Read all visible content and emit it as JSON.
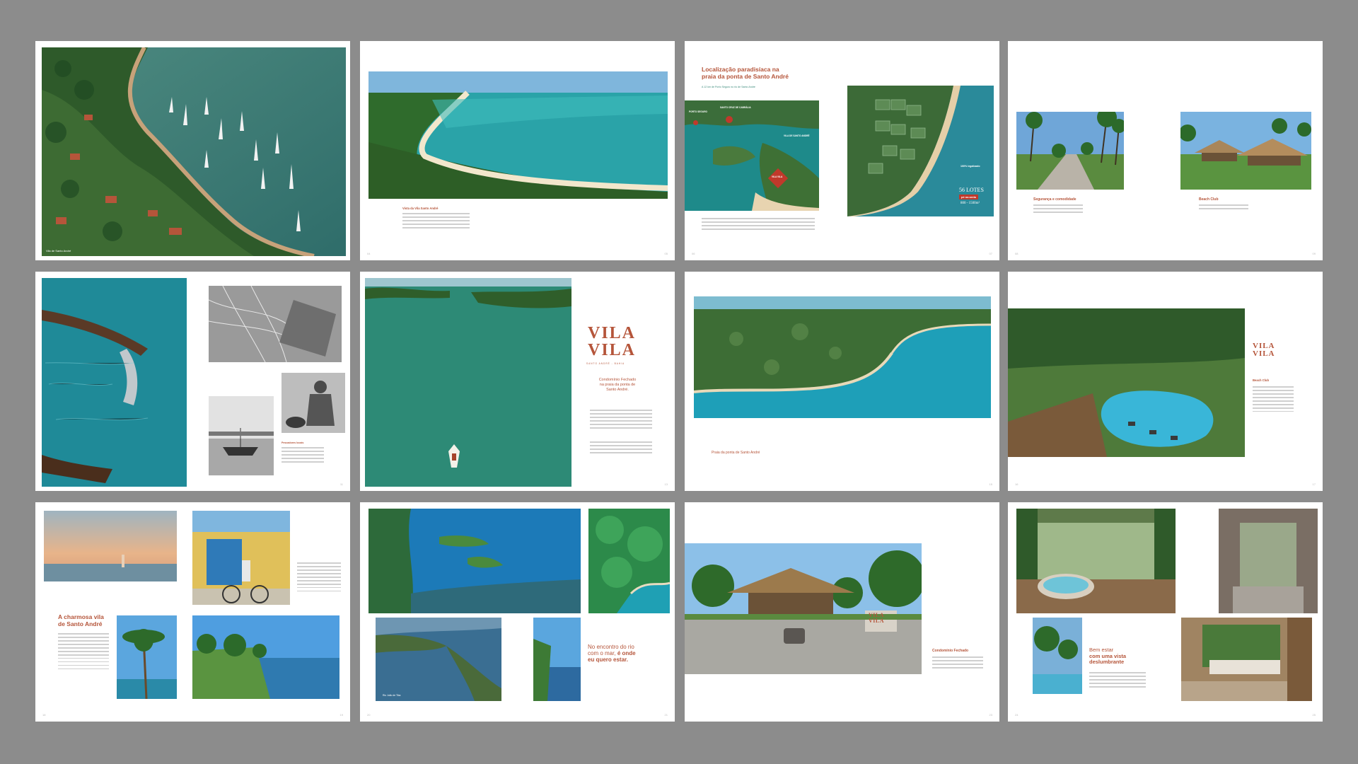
{
  "spreads": {
    "s1": {
      "caption": "Vila de Santo André",
      "page_left": "02",
      "page_right": "03"
    },
    "s2": {
      "heading": "Vista da Vila Santo André",
      "page_left": "04",
      "page_right": "05"
    },
    "s3": {
      "title_line1": "Localização paradisíaca na",
      "title_line2": "praia da ponta de Santo André",
      "subtitle": "A 12 km de Porto Seguro no rio de Santo André",
      "map_label_1": "SANTO CRUZ DE CABRÁLIA",
      "map_label_2": "PORTO SEGURO",
      "map_label_3": "VILA DE SANTO ANDRÉ",
      "map_pin": "VILA VILA",
      "badge_1": "100% legalizado",
      "badge_2": "56 LOTES",
      "badge_3": "pé na areia",
      "badge_4": "800 - 1500m²",
      "page_left": "06",
      "page_right": "07"
    },
    "s4": {
      "heading_left": "Segurança e comodidade",
      "heading_right": "Beach Club",
      "page_left": "08",
      "page_right": "09"
    },
    "s5": {
      "heading": "Pescadores locais",
      "page_left": "10",
      "page_right": "11"
    },
    "s6": {
      "logo_line1": "VILA",
      "logo_line2": "VILA",
      "logo_tagline": "SANTO ANDRÉ - BAHIA",
      "sub1": "Condomínio Fechado",
      "sub2": "na praia da ponta de",
      "sub3": "Santo André.",
      "page_left": "12",
      "page_right": "13"
    },
    "s7": {
      "caption": "Praia da ponta de Santo André",
      "page_left": "14",
      "page_right": "15"
    },
    "s8": {
      "logo_line1": "VILA",
      "logo_line2": "VILA",
      "heading": "Beach Club",
      "page_left": "16",
      "page_right": "17"
    },
    "s9": {
      "title_line1": "A charmosa vila",
      "title_line2": "de Santo André",
      "page_left": "18",
      "page_right": "19"
    },
    "s10": {
      "title_line1": "No encontro do rio",
      "title_line2": "com o mar,",
      "title_line2b": "é onde",
      "title_line3": "eu quero estar.",
      "caption": "Rio João de Tiba",
      "page_left": "20",
      "page_right": "21"
    },
    "s11": {
      "heading": "Condomínio Fechado",
      "sign_line1": "VILA",
      "sign_line2": "VILA",
      "page_left": "22",
      "page_right": "23"
    },
    "s12": {
      "title_line1": "Bem estar",
      "title_line2": "com uma vista",
      "title_line3": "deslumbrante",
      "page_left": "24",
      "page_right": "25"
    }
  }
}
